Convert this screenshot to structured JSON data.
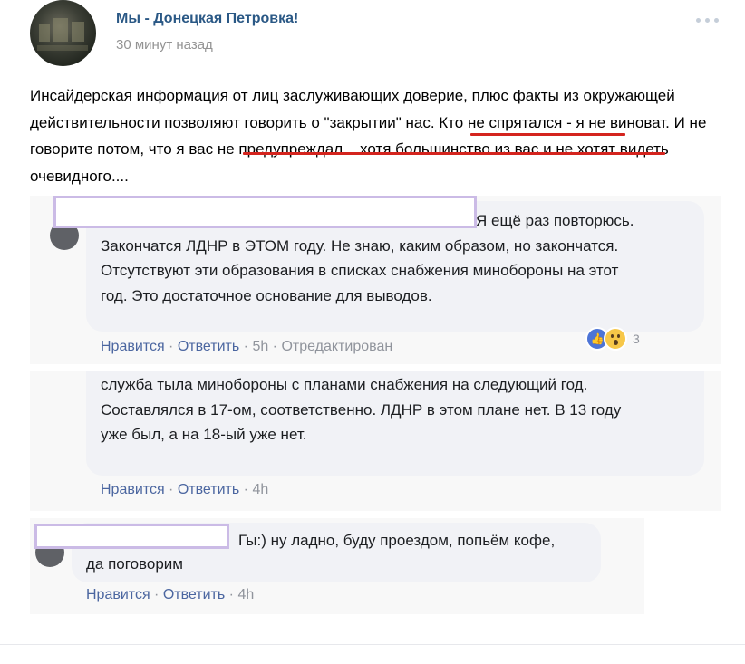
{
  "post": {
    "group_name": "Мы - Донецкая Петровка!",
    "time": "30 минут назад",
    "menu_icon": "more-dots-icon",
    "text": "Инсайдерская информация от лиц заслуживающих доверие, плюс факты из окружающей действительности позволяют говорить о \"закрытии\" нас. Кто не спрятался - я не виноват. И не говорите потом, что я вас не предупреждал... хотя большинство из вас и не хотят видеть очевидного...."
  },
  "comments": [
    {
      "text": "Я ещё раз повторюсь. Закончатся ЛДНР в ЭТОМ году. Не знаю, каким образом, но закончатся. Отсутствуют эти образования в списках снабжения минобороны на этот год. Это достаточное основание для выводов.",
      "like": "Нравится",
      "reply": "Ответить",
      "time": "5h",
      "edited": "Отредактирован",
      "reaction_count": "3"
    },
    {
      "text": "служба тыла минобороны с планами снабжения на следующий год. Составлялся в 17-ом, соответственно. ЛДНР в этом плане нет. В 13 году уже был, а на 18-ый уже нет.",
      "like": "Нравится",
      "reply": "Ответить",
      "time": "4h"
    },
    {
      "text": "Гы:) ну ладно, буду проездом, попьём кофе, да поговорим",
      "like": "Нравится",
      "reply": "Ответить",
      "time": "4h"
    }
  ],
  "colors": {
    "link": "#2a5885",
    "highlight_underline": "#d4241e",
    "redaction_border": "#cbbbe6",
    "action_link": "#4b66a0"
  }
}
